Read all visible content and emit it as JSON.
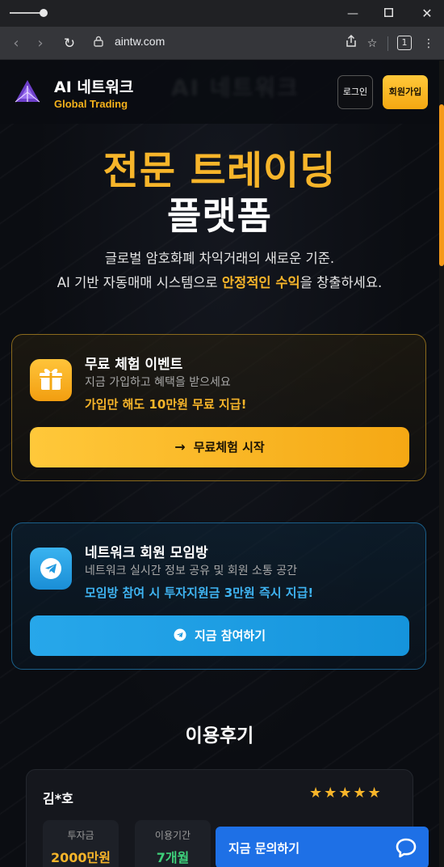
{
  "browser": {
    "url": "aintw.com",
    "tab_count": "1"
  },
  "header": {
    "logo_name": "AI 네트워크",
    "logo_sub": "Global Trading",
    "login_label": "로그인",
    "join_label": "회원가입"
  },
  "hero": {
    "title_line1": "전문 트레이딩",
    "title_line2": "플랫폼",
    "desc_line1": "글로벌 암호화폐 차익거래의 새로운 기준.",
    "desc_line2_pre": "AI 기반 자동매매 시스템으로 ",
    "desc_line2_hl": "안정적인 수익",
    "desc_line2_post": "을 창출하세요."
  },
  "trial_card": {
    "title": "무료 체험 이벤트",
    "subtitle": "지금 가입하고 혜택을 받으세요",
    "highlight": "가입만 해도 10만원 무료 지급!",
    "button_label": "무료체험 시작",
    "icon": "gift-icon",
    "accent": "#f7b52a"
  },
  "community_card": {
    "title": "네트워크 회원 모임방",
    "subtitle": "네트워크 실시간 정보 공유 및 회원 소통 공간",
    "highlight": "모임방 참여 시 투자지원금 3만원 즉시 지급!",
    "button_label": "지금 참여하기",
    "icon": "telegram-icon",
    "accent": "#3fb4f2"
  },
  "reviews": {
    "title": "이용후기",
    "items": [
      {
        "name": "김*호",
        "rating": 5,
        "stars": "★★★★★",
        "stats": [
          {
            "label": "투자금",
            "value": "2000만원",
            "color": "#f7b52a"
          },
          {
            "label": "이용기간",
            "value": "7개월",
            "color": "#3ecf7a"
          }
        ]
      }
    ]
  },
  "chat": {
    "label": "지금 문의하기",
    "icon": "chat-bubble-icon",
    "color": "#1e70e6"
  }
}
